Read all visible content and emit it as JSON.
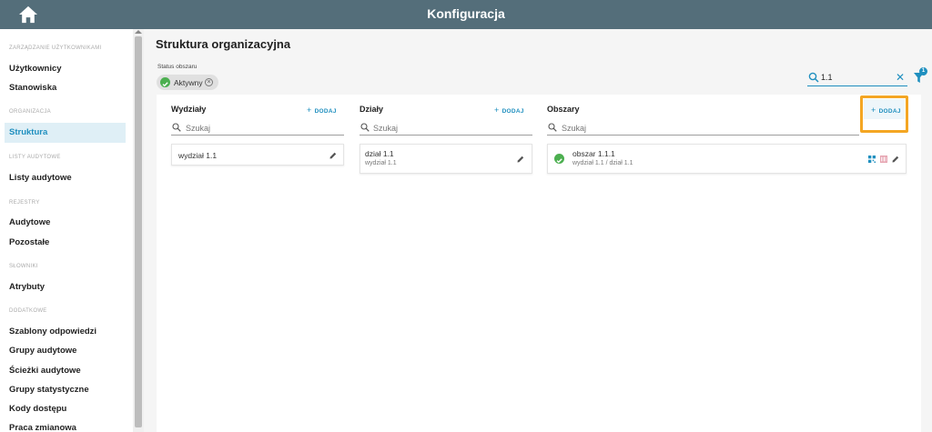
{
  "header": {
    "title": "Konfiguracja",
    "home_icon": "home-icon"
  },
  "sidebar": {
    "sections": [
      {
        "title": "ZARZĄDZANIE UŻYTKOWNIKAMI",
        "items": [
          "Użytkownicy",
          "Stanowiska"
        ]
      },
      {
        "title": "ORGANIZACJA",
        "items": [
          "Struktura"
        ]
      },
      {
        "title": "LISTY AUDYTOWE",
        "items": [
          "Listy audytowe"
        ]
      },
      {
        "title": "REJESTRY",
        "items": [
          "Audytowe",
          "Pozostałe"
        ]
      },
      {
        "title": "SŁOWNIKI",
        "items": [
          "Atrybuty"
        ]
      },
      {
        "title": "DODATKOWE",
        "items": [
          "Szablony odpowiedzi",
          "Grupy audytowe",
          "Ścieżki audytowe",
          "Grupy statystyczne",
          "Kody dostępu",
          "Praca zmianowa"
        ]
      }
    ],
    "active_item": "Struktura"
  },
  "page": {
    "title": "Struktura organizacyjna"
  },
  "filters": {
    "status_label": "Status obszaru",
    "status_chip": "Aktywny",
    "search_value": "1.1",
    "filter_count": "1"
  },
  "columns": {
    "wydzialy": {
      "title": "Wydziały",
      "add_label": "DODAJ",
      "search_placeholder": "Szukaj",
      "items": [
        {
          "title": "wydział 1.1"
        }
      ]
    },
    "dzialy": {
      "title": "Działy",
      "add_label": "DODAJ",
      "search_placeholder": "Szukaj",
      "items": [
        {
          "title": "dział 1.1",
          "subtitle": "wydział 1.1"
        }
      ]
    },
    "obszary": {
      "title": "Obszary",
      "add_label": "DODAJ",
      "search_placeholder": "Szukaj",
      "items": [
        {
          "title": "obszar 1.1.1",
          "subtitle": "wydział 1.1 / dział 1.1",
          "status": "active"
        }
      ]
    }
  },
  "colors": {
    "header": "#546e7a",
    "accent": "#1f8fbf",
    "active": "#4caf50",
    "highlight": "#f4a623"
  }
}
